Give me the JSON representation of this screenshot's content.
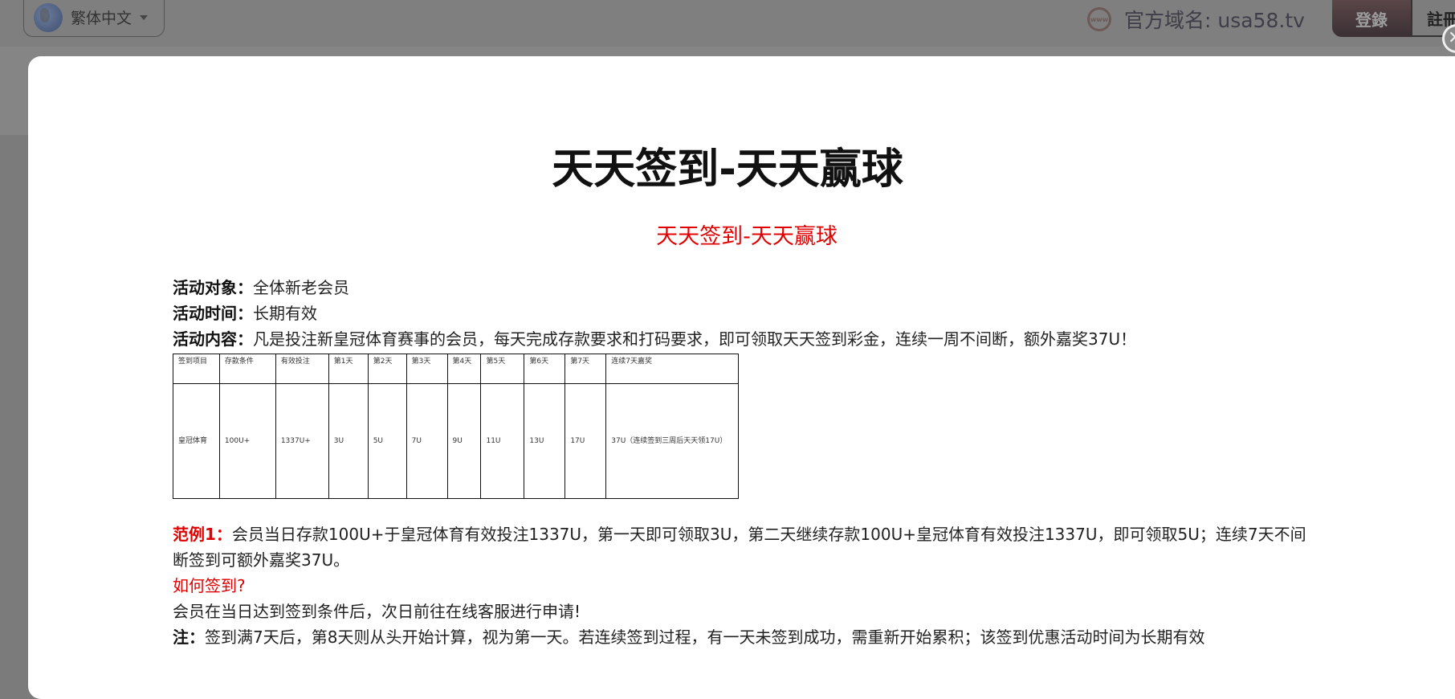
{
  "header": {
    "language": "繁体中文",
    "domain_label": "官方域名: usa58.tv",
    "login": "登錄",
    "register": "註冊",
    "www_icon": "www"
  },
  "promo": {
    "title": "天天签到-天天赢球",
    "subtitle": "天天签到-天天赢球",
    "target_label": "活动对象：",
    "target": "全体新老会员",
    "time_label": "活动时间：",
    "time": "长期有效",
    "content_label": "活动内容：",
    "content": "凡是投注新皇冠体育赛事的会员，每天完成存款要求和打码要求，即可领取天天签到彩金，连续一周不间断，额外嘉奖37U！",
    "table": {
      "headers": [
        "签到项目",
        "存款条件",
        "有效投注",
        "第1天",
        "第2天",
        "第3天",
        "第4天",
        "第5天",
        "第6天",
        "第7天",
        "连续7天嘉奖"
      ],
      "row": [
        "皇冠体育",
        "100U+",
        "1337U+",
        "3U",
        "5U",
        "7U",
        "9U",
        "11U",
        "13U",
        "17U",
        "37U（连续签到三周后天天领17U）"
      ]
    },
    "example_label": "范例1：",
    "example": "会员当日存款100U+于皇冠体育有效投注1337U，第一天即可领取3U，第二天继续存款100U+皇冠体育有效投注1337U，即可领取5U；连续7天不间断签到可额外嘉奖37U。",
    "how_title": "如何签到?",
    "how": "会员在当日达到签到条件后，次日前往在线客服进行申请!",
    "note_label": "注：",
    "note": "签到满7天后，第8天则从头开始计算，视为第一天。若连续签到过程，有一天未签到成功，需重新开始累积；该签到优惠活动时间为长期有效"
  }
}
